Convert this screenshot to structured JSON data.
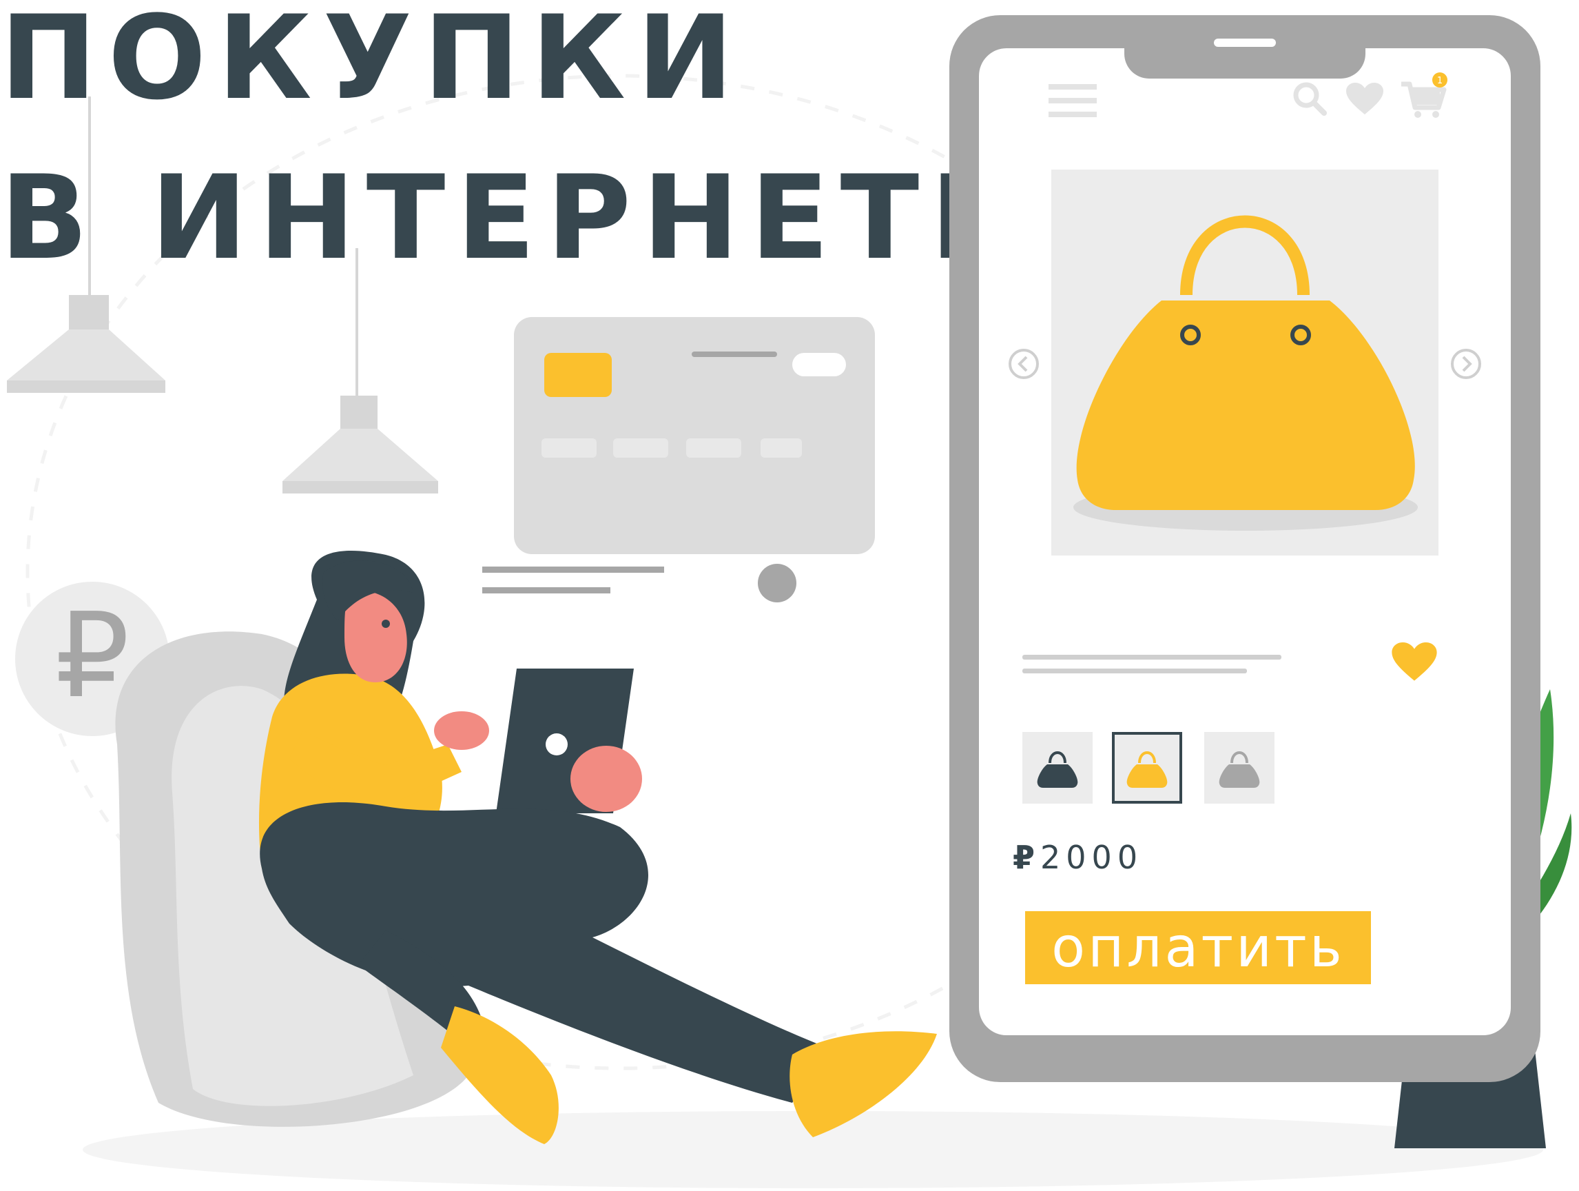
{
  "headline": {
    "line1": "ПОКУПКИ",
    "line2": "В ИНТЕРНЕТЕ"
  },
  "colors": {
    "dark": "#37474f",
    "accent": "#fbc02d",
    "grey": "#a6a6a6",
    "light_grey": "#ececec",
    "plant": "#43a047",
    "skin": "#f28b82"
  },
  "decor": {
    "coin_symbol": "₽"
  },
  "phone": {
    "header_icons": [
      "menu-icon",
      "search-icon",
      "heart-icon",
      "cart-icon"
    ],
    "cart_badge": "1",
    "gallery": {
      "prev_icon": "chevron-left-icon",
      "next_icon": "chevron-right-icon"
    },
    "thumbnails": [
      {
        "name": "dark-bag",
        "color": "#37474f",
        "selected": false
      },
      {
        "name": "yellow-bag",
        "color": "#fbc02d",
        "selected": true
      },
      {
        "name": "grey-bag",
        "color": "#a6a6a6",
        "selected": false
      }
    ],
    "price": {
      "currency": "₽",
      "amount": "2000"
    },
    "pay_button_label": "оплатить"
  }
}
